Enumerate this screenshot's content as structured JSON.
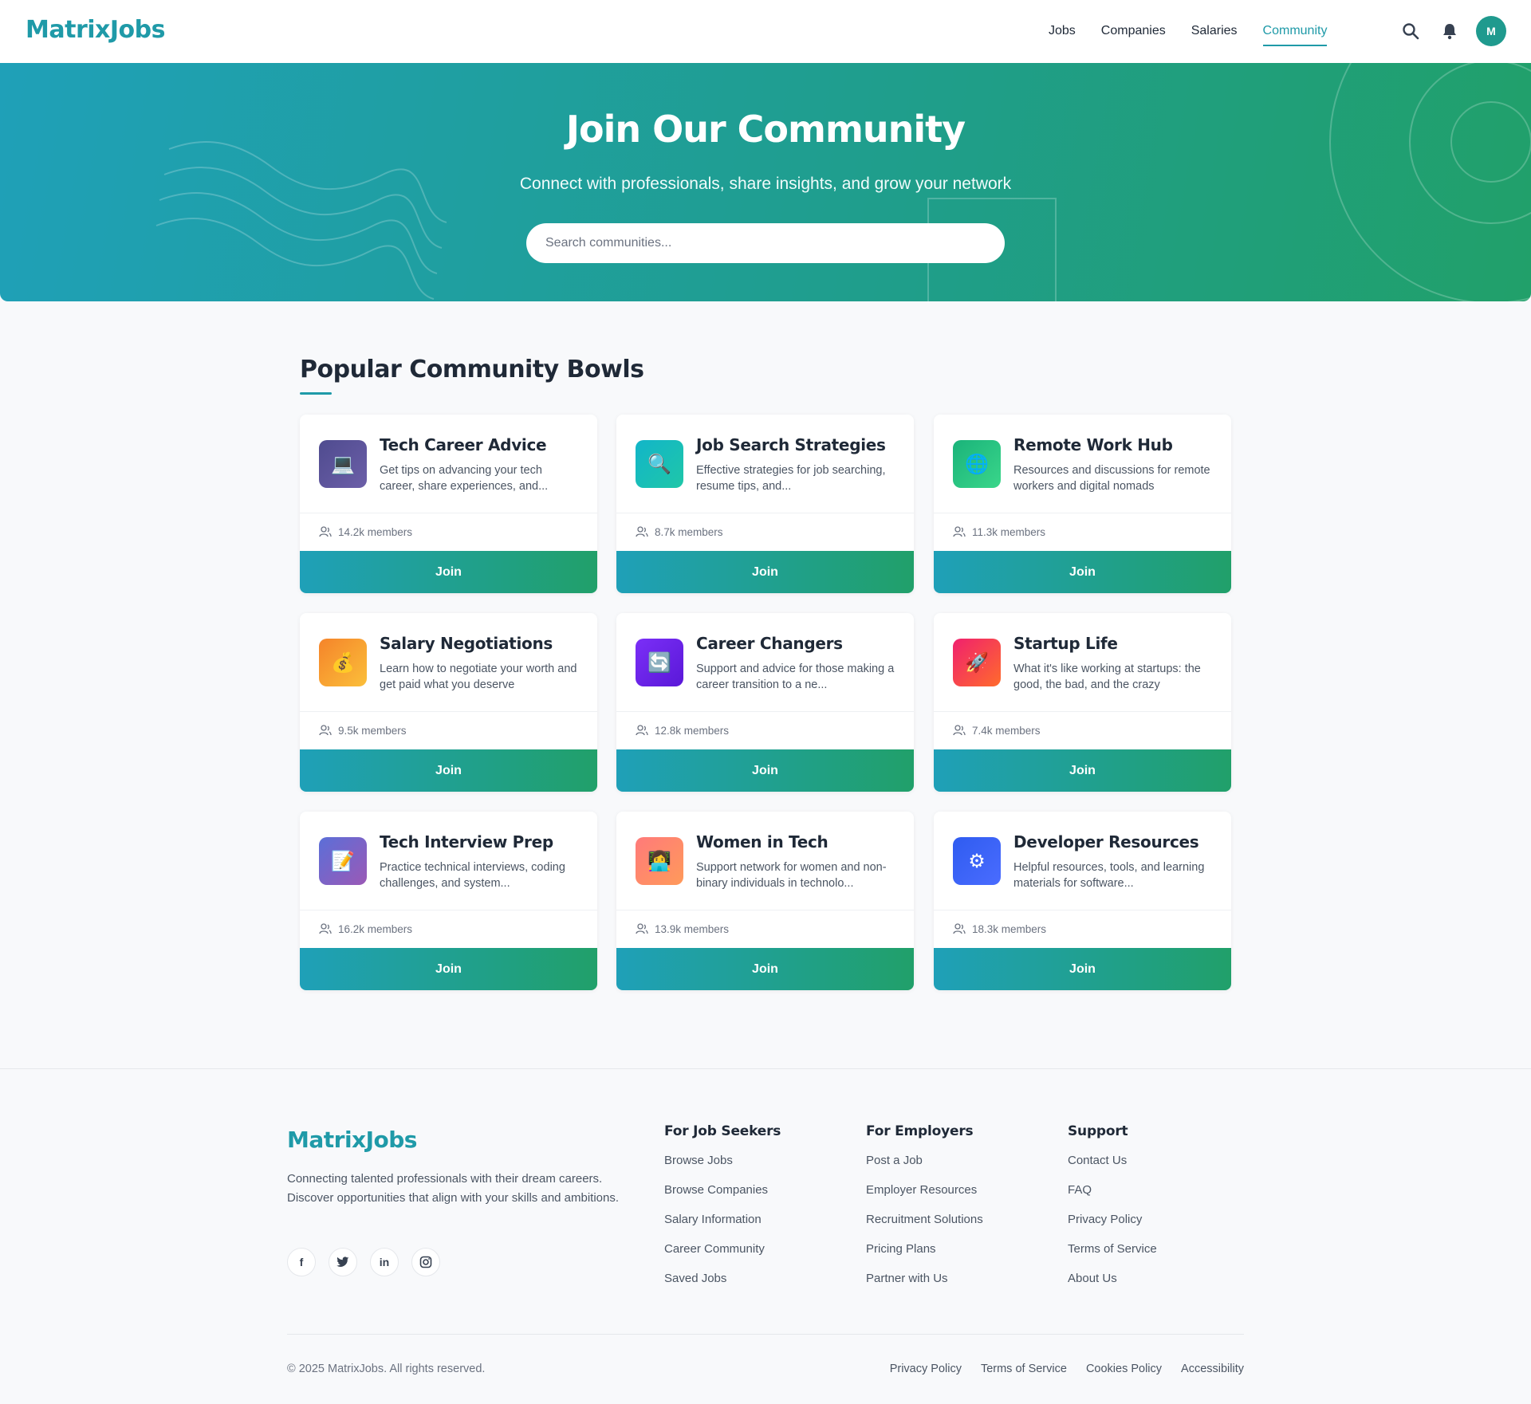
{
  "brand": {
    "name": "MatrixJobs"
  },
  "nav": {
    "items": [
      {
        "label": "Jobs",
        "active": false
      },
      {
        "label": "Companies",
        "active": false
      },
      {
        "label": "Salaries",
        "active": false
      },
      {
        "label": "Community",
        "active": true
      }
    ],
    "avatar_initial": "M"
  },
  "hero": {
    "title": "Join Our Community",
    "subtitle": "Connect with professionals, share insights, and grow your network",
    "search_placeholder": "Search communities..."
  },
  "section": {
    "title": "Popular Community Bowls"
  },
  "communities": [
    {
      "title": "Tech Career Advice",
      "desc": "Get tips on advancing your tech career, share experiences, and...",
      "members": "14.2k members",
      "icon": "laptop-icon",
      "glyph": "💻",
      "join": "Join"
    },
    {
      "title": "Job Search Strategies",
      "desc": "Effective strategies for job searching, resume tips, and...",
      "members": "8.7k members",
      "icon": "magnifier-icon",
      "glyph": "🔍",
      "join": "Join"
    },
    {
      "title": "Remote Work Hub",
      "desc": "Resources and discussions for remote workers and digital nomads",
      "members": "11.3k members",
      "icon": "globe-icon",
      "glyph": "🌐",
      "join": "Join"
    },
    {
      "title": "Salary Negotiations",
      "desc": "Learn how to negotiate your worth and get paid what you deserve",
      "members": "9.5k members",
      "icon": "money-bag-icon",
      "glyph": "💰",
      "join": "Join"
    },
    {
      "title": "Career Changers",
      "desc": "Support and advice for those making a career transition to a ne...",
      "members": "12.8k members",
      "icon": "refresh-icon",
      "glyph": "🔄",
      "join": "Join"
    },
    {
      "title": "Startup Life",
      "desc": "What it's like working at startups: the good, the bad, and the crazy",
      "members": "7.4k members",
      "icon": "rocket-icon",
      "glyph": "🚀",
      "join": "Join"
    },
    {
      "title": "Tech Interview Prep",
      "desc": "Practice technical interviews, coding challenges, and system...",
      "members": "16.2k members",
      "icon": "memo-icon",
      "glyph": "📝",
      "join": "Join"
    },
    {
      "title": "Women in Tech",
      "desc": "Support network for women and non-binary individuals in technolo...",
      "members": "13.9k members",
      "icon": "woman-technologist-icon",
      "glyph": "👩‍💻",
      "join": "Join"
    },
    {
      "title": "Developer Resources",
      "desc": "Helpful resources, tools, and learning materials for software...",
      "members": "18.3k members",
      "icon": "gear-icon",
      "glyph": "⚙",
      "join": "Join"
    }
  ],
  "footer": {
    "brand": "MatrixJobs",
    "about": "Connecting talented professionals with their dream careers. Discover opportunities that align with your skills and ambitions.",
    "socials": [
      {
        "name": "facebook-icon",
        "glyph": "f"
      },
      {
        "name": "twitter-icon",
        "glyph": "🐦"
      },
      {
        "name": "linkedin-icon",
        "glyph": "in"
      },
      {
        "name": "instagram-icon",
        "glyph": "◎"
      }
    ],
    "columns": [
      {
        "heading": "For Job Seekers",
        "links": [
          "Browse Jobs",
          "Browse Companies",
          "Salary Information",
          "Career Community",
          "Saved Jobs"
        ]
      },
      {
        "heading": "For Employers",
        "links": [
          "Post a Job",
          "Employer Resources",
          "Recruitment Solutions",
          "Pricing Plans",
          "Partner with Us"
        ]
      },
      {
        "heading": "Support",
        "links": [
          "Contact Us",
          "FAQ",
          "Privacy Policy",
          "Terms of Service",
          "About Us"
        ]
      }
    ],
    "copyright": "© 2025 MatrixJobs. All rights reserved.",
    "legal": [
      "Privacy Policy",
      "Terms of Service",
      "Cookies Policy",
      "Accessibility"
    ]
  },
  "colors": {
    "accent": "#1f9aa8",
    "accent_green": "#21a06a"
  }
}
